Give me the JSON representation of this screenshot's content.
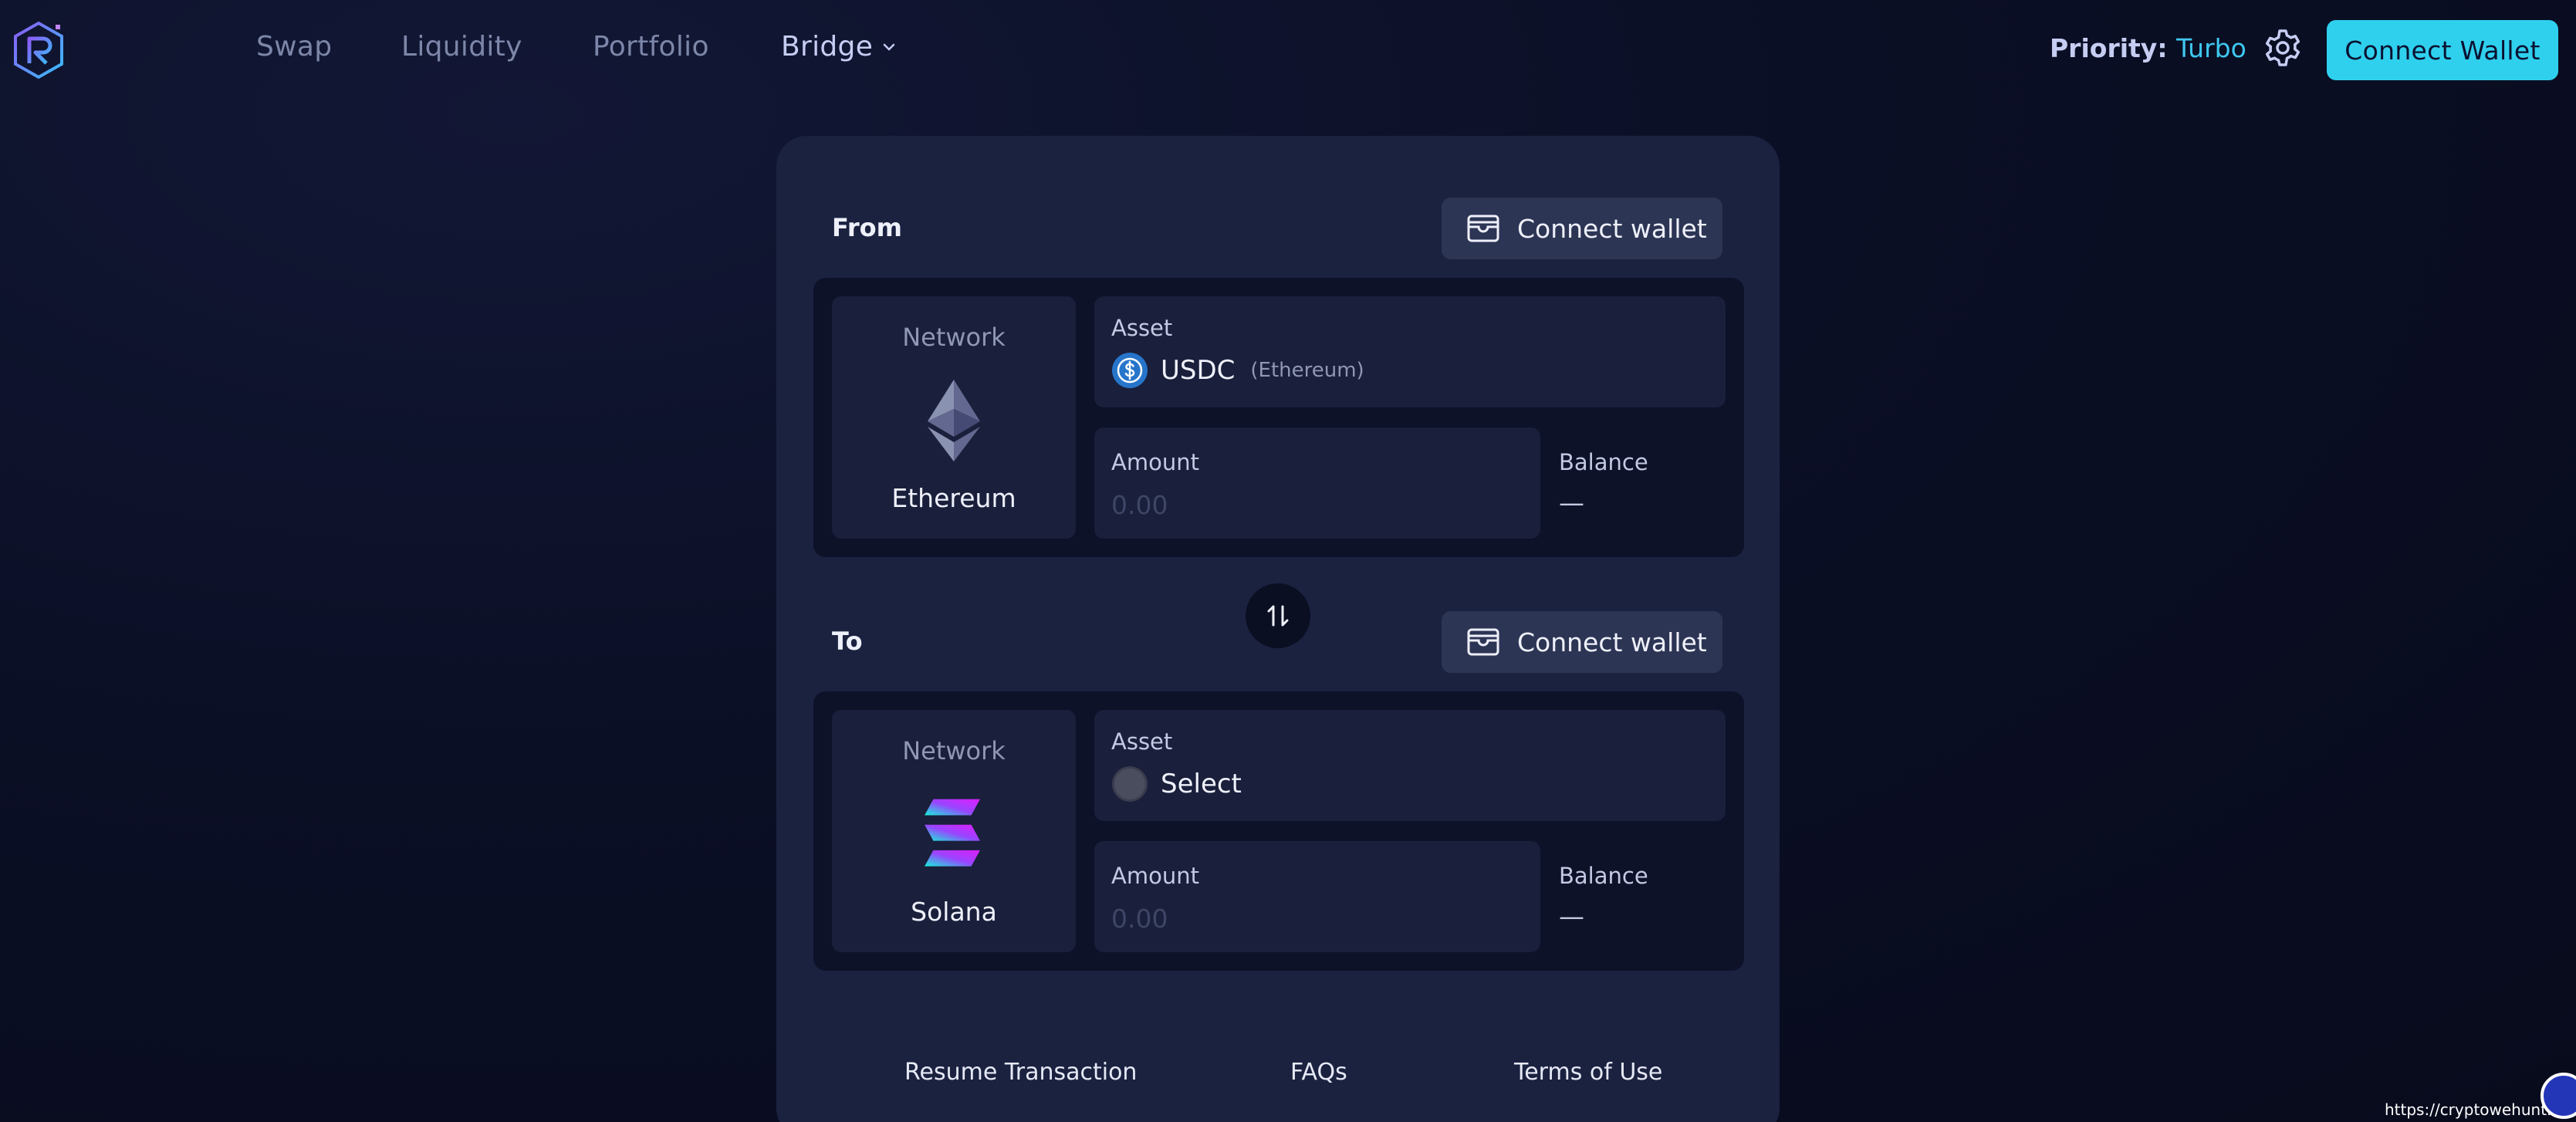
{
  "header": {
    "nav": [
      {
        "label": "Swap"
      },
      {
        "label": "Liquidity"
      },
      {
        "label": "Portfolio"
      },
      {
        "label": "Bridge"
      }
    ],
    "priority_label": "Priority:",
    "priority_value": "Turbo",
    "connect_label": "Connect Wallet"
  },
  "bridge": {
    "from": {
      "label": "From",
      "wallet_button": "Connect wallet",
      "network_label": "Network",
      "network_name": "Ethereum",
      "network_icon": "ethereum-icon",
      "asset_label": "Asset",
      "asset_name": "USDC",
      "asset_chain": "(Ethereum)",
      "asset_icon": "usdc-icon",
      "amount_label": "Amount",
      "amount_placeholder": "0.00",
      "balance_label": "Balance",
      "balance_value": "—"
    },
    "to": {
      "label": "To",
      "wallet_button": "Connect wallet",
      "network_label": "Network",
      "network_name": "Solana",
      "network_icon": "solana-icon",
      "asset_label": "Asset",
      "asset_name": "Select",
      "asset_icon": "placeholder-token-icon",
      "amount_label": "Amount",
      "amount_placeholder": "0.00",
      "balance_label": "Balance",
      "balance_value": "—"
    },
    "footer": {
      "resume": "Resume Transaction",
      "faqs": "FAQs",
      "terms": "Terms of Use"
    }
  },
  "watermark": "https://cryptowehunt.com",
  "colors": {
    "accent": "#2fd0ee",
    "priority": "#3ec8f0",
    "card": "#1b2240",
    "panel": "#0d1229"
  }
}
